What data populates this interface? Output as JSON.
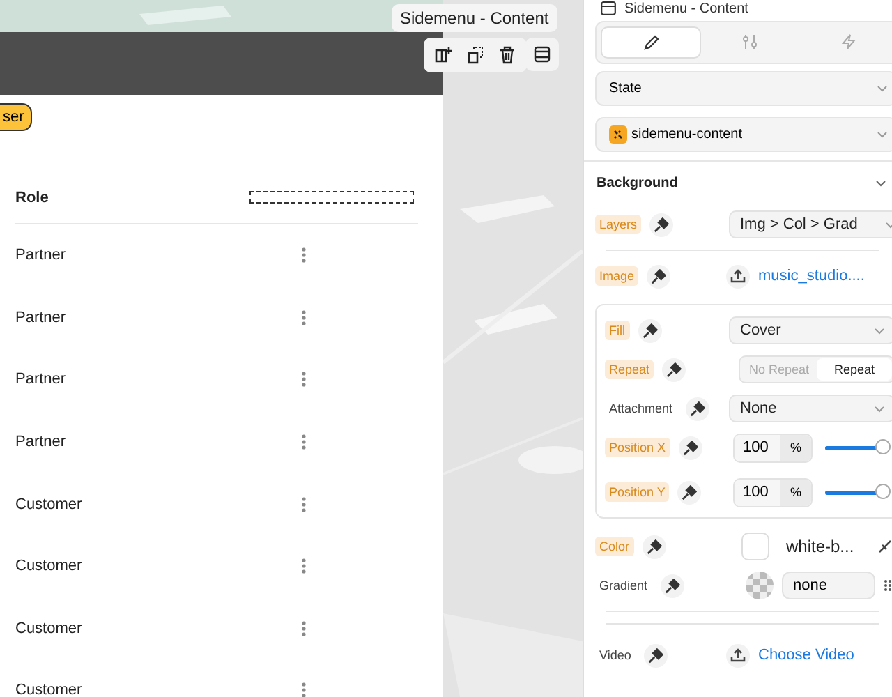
{
  "canvas": {
    "element_label": "Sidemenu - Content",
    "badge": "ser",
    "table": {
      "columns": [
        "Role"
      ],
      "rows": [
        {
          "role": "Partner"
        },
        {
          "role": "Partner"
        },
        {
          "role": "Partner"
        },
        {
          "role": "Partner"
        },
        {
          "role": "Customer"
        },
        {
          "role": "Customer"
        },
        {
          "role": "Customer"
        },
        {
          "role": "Customer"
        }
      ]
    }
  },
  "inspector": {
    "title": "Sidemenu - Content",
    "tabs": [
      {
        "selected": true
      },
      {
        "selected": false
      },
      {
        "selected": false
      }
    ],
    "state_dropdown": "State",
    "class_dropdown": "sidemenu-content",
    "section": {
      "title": "Background",
      "expanded": true,
      "properties": [
        {
          "kind": "select",
          "label": "Layers",
          "set": true,
          "value": "Img > Col > Grad"
        },
        {
          "kind": "file",
          "label": "Image",
          "set": true,
          "value": "music_studio...."
        },
        {
          "kind": "group",
          "children": [
            {
              "kind": "select",
              "label": "Fill",
              "set": true,
              "value": "Cover"
            },
            {
              "kind": "segmented",
              "label": "Repeat",
              "set": true,
              "options": [
                {
                  "label": "No Repeat",
                  "selected": false
                },
                {
                  "label": "Repeat",
                  "selected": true
                }
              ]
            },
            {
              "kind": "select",
              "label": "Attachment",
              "set": false,
              "value": "None"
            },
            {
              "kind": "number",
              "label": "Position X",
              "set": true,
              "value": "100",
              "unit": "%",
              "level": 1
            },
            {
              "kind": "number",
              "label": "Position Y",
              "set": true,
              "value": "100",
              "unit": "%",
              "level": 1
            }
          ]
        },
        {
          "kind": "color",
          "label": "Color",
          "set": true,
          "value": "white-b..."
        },
        {
          "kind": "gradient",
          "label": "Gradient",
          "set": false,
          "value": "none"
        },
        {
          "kind": "file",
          "label": "Video",
          "set": false,
          "value": "Choose Video"
        }
      ]
    }
  }
}
